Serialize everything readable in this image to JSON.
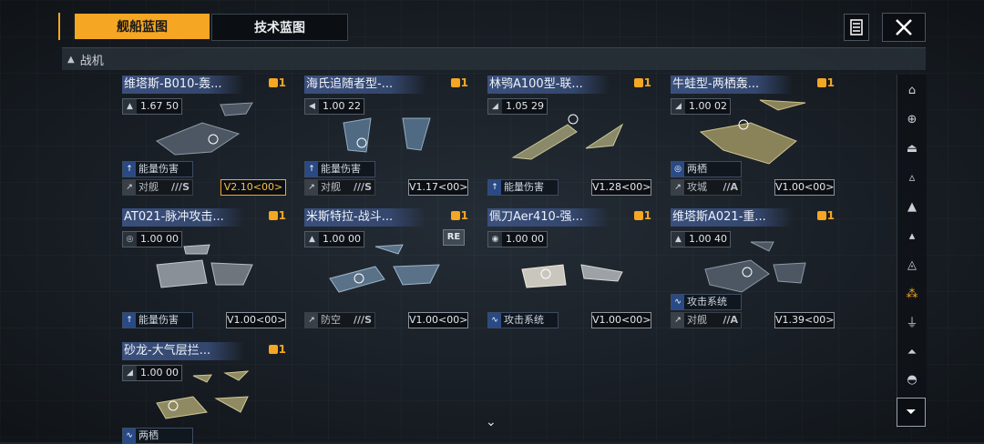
{
  "tabs": [
    {
      "label": "舰船蓝图",
      "active": true
    },
    {
      "label": "技术蓝图",
      "active": false
    }
  ],
  "section": {
    "title": "战机"
  },
  "colors": {
    "accent": "#f5a623",
    "name_bar": "#34476e",
    "trait_icon": "#2a4a86"
  },
  "cards": [
    {
      "name": "维塔斯-B010-轰...",
      "count": "1",
      "cost": "1.67 50",
      "trait": "能量伤害",
      "role": "对舰",
      "role_class": "///S",
      "version": "V2.10<00>",
      "version_highlight": true,
      "badge": ""
    },
    {
      "name": "海氏追随者型-...",
      "count": "1",
      "cost": "1.00 22",
      "trait": "能量伤害",
      "role": "对舰",
      "role_class": "///S",
      "version": "V1.17<00>",
      "version_highlight": false,
      "badge": ""
    },
    {
      "name": "林鸮A100型-联...",
      "count": "1",
      "cost": "1.05 29",
      "trait": "能量伤害",
      "role": "",
      "role_class": "",
      "version": "V1.28<00>",
      "version_highlight": false,
      "badge": ""
    },
    {
      "name": "牛蛙型-两栖轰...",
      "count": "1",
      "cost": "1.00 02",
      "trait": "两栖",
      "role": "攻城",
      "role_class": "//A",
      "version": "V1.00<00>",
      "version_highlight": false,
      "badge": ""
    },
    {
      "name": "AT021-脉冲攻击...",
      "count": "1",
      "cost": "1.00 00",
      "trait": "能量伤害",
      "role": "",
      "role_class": "",
      "version": "V1.00<00>",
      "version_highlight": false,
      "badge": ""
    },
    {
      "name": "米斯特拉-战斗...",
      "count": "1",
      "cost": "1.00 00",
      "trait": "",
      "role": "防空",
      "role_class": "///S",
      "version": "V1.00<00>",
      "version_highlight": false,
      "badge": "RE"
    },
    {
      "name": "佩刀Aer410-强...",
      "count": "1",
      "cost": "1.00 00",
      "trait": "攻击系统",
      "role": "",
      "role_class": "",
      "version": "V1.00<00>",
      "version_highlight": false,
      "badge": ""
    },
    {
      "name": "维塔斯A021-重...",
      "count": "1",
      "cost": "1.00 40",
      "trait": "攻击系统",
      "role": "对舰",
      "role_class": "//A",
      "version": "V1.39<00>",
      "version_highlight": false,
      "badge": ""
    },
    {
      "name": "砂龙-大气层拦...",
      "count": "1",
      "cost": "1.00 00",
      "trait": "两栖",
      "role": "",
      "role_class": "",
      "version": "",
      "version_highlight": false,
      "badge": ""
    }
  ],
  "rail_icons": [
    "carrier-icon",
    "destroyer-icon",
    "cruiser-icon",
    "frigate-icon",
    "corvette-icon",
    "gunship-icon",
    "support-icon",
    "fighter-icon",
    "bomber-icon",
    "dome-icon",
    "station-icon"
  ]
}
